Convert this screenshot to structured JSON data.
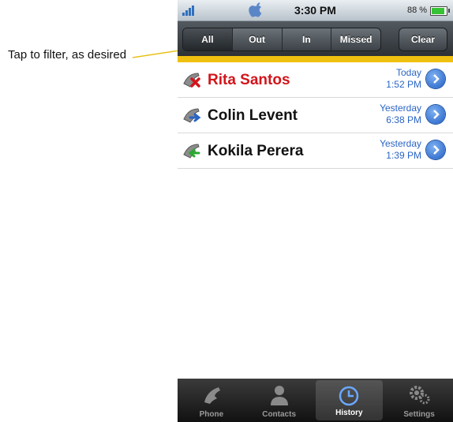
{
  "annotation": {
    "text": "Tap to filter, as desired"
  },
  "status_bar": {
    "time": "3:30 PM",
    "battery": "88 %",
    "battery_level": 0.88,
    "signal_icon": "signal-bars-icon",
    "logo_icon": "apple-icon"
  },
  "filter_bar": {
    "segments": [
      {
        "label": "All",
        "active": true
      },
      {
        "label": "Out",
        "active": false
      },
      {
        "label": "In",
        "active": false
      },
      {
        "label": "Missed",
        "active": false
      }
    ],
    "clear_label": "Clear"
  },
  "calls": [
    {
      "name": "Rita Santos",
      "day": "Today",
      "time": "1:52 PM",
      "type": "missed",
      "icon": "missed-call-icon"
    },
    {
      "name": "Colin Levent",
      "day": "Yesterday",
      "time": "6:38 PM",
      "type": "outgoing",
      "icon": "outgoing-call-icon"
    },
    {
      "name": "Kokila Perera",
      "day": "Yesterday",
      "time": "1:39 PM",
      "type": "incoming",
      "icon": "incoming-call-icon"
    }
  ],
  "tab_bar": [
    {
      "label": "Phone",
      "icon": "phone-icon",
      "active": false
    },
    {
      "label": "Contacts",
      "icon": "contacts-icon",
      "active": false
    },
    {
      "label": "History",
      "icon": "clock-icon",
      "active": true
    },
    {
      "label": "Settings",
      "icon": "gears-icon",
      "active": false
    }
  ],
  "colors": {
    "accent_stripe": "#f0c010",
    "missed_name": "#d2151b",
    "timestamp": "#2a64c4",
    "callout_line": "#e8c21a"
  }
}
